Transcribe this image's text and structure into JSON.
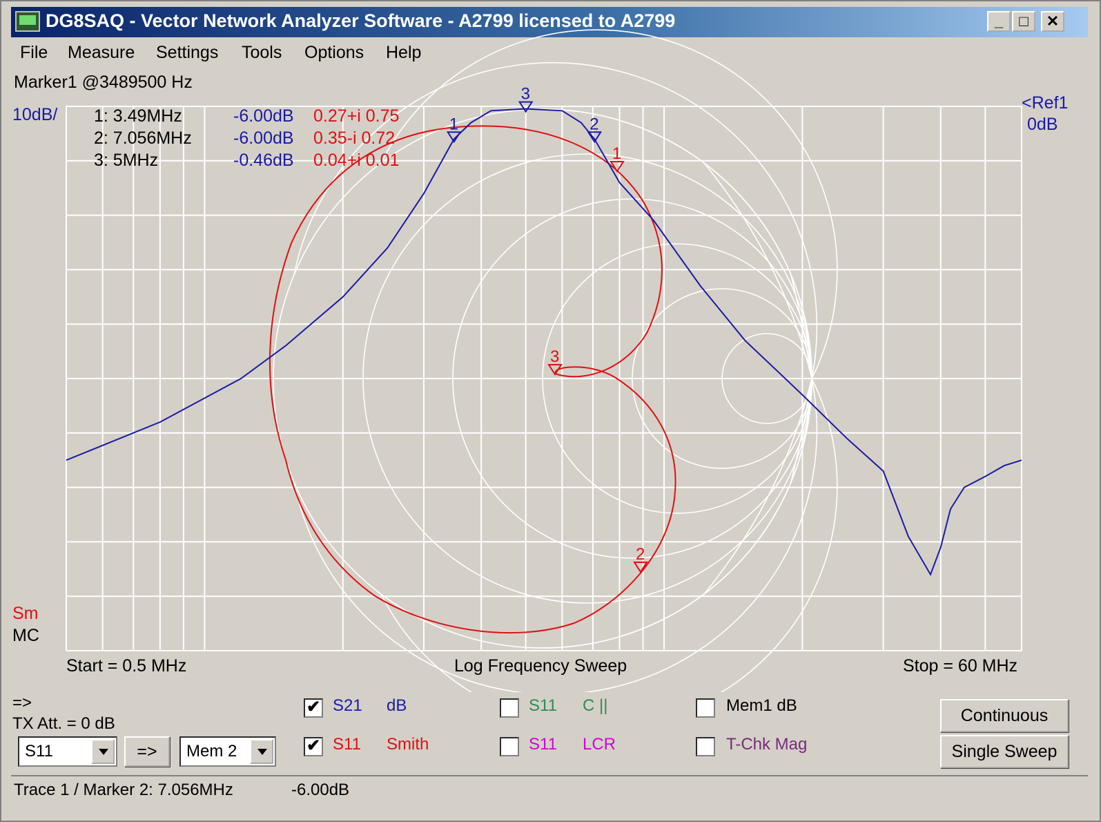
{
  "window": {
    "title": "DG8SAQ  -  Vector Network Analyzer Software  - A2799 licensed to A2799",
    "minimize": "_",
    "maximize": "□",
    "close": "✕"
  },
  "menu": [
    "File",
    "Measure",
    "Settings",
    "Tools",
    "Options",
    "Help"
  ],
  "plot": {
    "marker_title": "Marker1 @3489500 Hz",
    "scale_label": "10dB/",
    "ref_label": "<Ref1",
    "ref_value": "0dB",
    "sm_label": "Sm",
    "mc_label": "MC",
    "start_label": "Start = 0.5 MHz",
    "sweep_label": "Log Frequency Sweep",
    "stop_label": "Stop = 60 MHz",
    "colors": {
      "s21": "#1a1aa8",
      "s11": "#e01010",
      "grid": "#ffffff",
      "bg": "#d4d0c8"
    },
    "marker_table": [
      {
        "name": "1: 3.49MHz",
        "db": "-6.00dB",
        "z": "0.27+i 0.75"
      },
      {
        "name": "2: 7.056MHz",
        "db": "-6.00dB",
        "z": "0.35-i 0.72"
      },
      {
        "name": "3: 5MHz",
        "db": "-0.46dB",
        "z": "0.04+i 0.01"
      }
    ],
    "marker_ids": [
      "1",
      "2",
      "3"
    ]
  },
  "chart_data": {
    "type": "line",
    "x_axis": {
      "scale": "log",
      "min_mhz": 0.5,
      "max_mhz": 60
    },
    "y_axis": {
      "scale_per_div_db": 10,
      "ref_db": 0
    },
    "grid": true,
    "series": [
      {
        "name": "S21",
        "unit": "dB",
        "x_mhz": [
          0.5,
          0.8,
          1.2,
          1.5,
          2.0,
          2.5,
          3.0,
          3.49,
          3.8,
          4.2,
          5.0,
          6.0,
          6.6,
          7.056,
          8.0,
          9.5,
          12,
          15,
          20,
          25,
          30,
          34,
          38,
          40,
          42,
          45,
          50,
          55,
          60
        ],
        "y_db": [
          -65,
          -58,
          -50,
          -44,
          -35,
          -26,
          -16,
          -6,
          -3,
          -0.8,
          -0.46,
          -0.8,
          -3,
          -6,
          -14,
          -21,
          -33,
          -43,
          -53,
          -61,
          -67,
          -79,
          -86,
          -81,
          -74,
          -70,
          -68,
          -66,
          -65
        ]
      }
    ],
    "markers": [
      {
        "id": "1",
        "freq_mhz": 3.49,
        "s21_db": -6.0,
        "s11_z": "0.27+i 0.75"
      },
      {
        "id": "2",
        "freq_mhz": 7.056,
        "s21_db": -6.0,
        "s11_z": "0.35-i 0.72"
      },
      {
        "id": "3",
        "freq_mhz": 5,
        "s21_db": -0.46,
        "s11_z": "0.04+i 0.01"
      }
    ]
  },
  "bottom": {
    "arrow_label": "=>",
    "tx_att_label": "TX Att.  = 0 dB",
    "combo1_value": "S11",
    "transfer_button": "=>",
    "combo2_value": "Mem 2",
    "checks": [
      {
        "param": "S21",
        "mode": "dB",
        "checked": true,
        "color": "#1a1aa8"
      },
      {
        "param": "S11",
        "mode": "Smith",
        "checked": true,
        "color": "#e01010"
      },
      {
        "param": "S11",
        "mode": "C ||",
        "checked": false,
        "color": "#2e8b57"
      },
      {
        "param": "S11",
        "mode": "LCR",
        "checked": false,
        "color": "#d400d4"
      },
      {
        "param": "",
        "mode": "Mem1 dB",
        "checked": false,
        "color": "#000000"
      },
      {
        "param": "",
        "mode": "T-Chk Mag",
        "checked": false,
        "color": "#7a2a7a"
      }
    ],
    "continuous_button": "Continuous",
    "single_sweep_button": "Single Sweep",
    "check_mark": "✔"
  },
  "status": {
    "trace_text": "Trace 1 / Marker 2: 7.056MHz",
    "value_text": "-6.00dB"
  }
}
